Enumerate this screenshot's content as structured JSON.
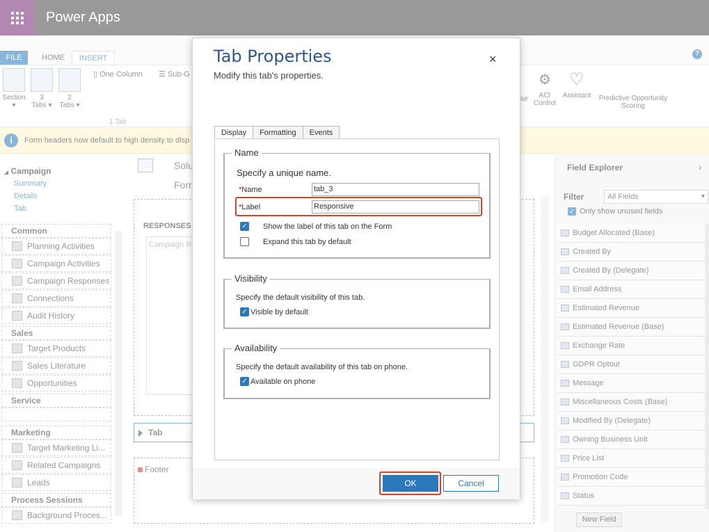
{
  "app": {
    "title": "Power Apps"
  },
  "ribbon": {
    "tabs": [
      "FILE",
      "HOME",
      "INSERT"
    ],
    "buttons": {
      "section": "Section",
      "three_tabs": [
        "3",
        "Tabs"
      ],
      "two_tabs": [
        "2",
        "Tabs"
      ],
      "one_column": "One Column",
      "sub_grid": "Sub-G",
      "ose": "se",
      "aci": [
        "ACI",
        "Control"
      ],
      "assistant": "Assistant",
      "predictive": [
        "Predictive Opportunity",
        "Scoring"
      ]
    },
    "group_label": "1 Tab"
  },
  "infobar": {
    "text": "Form headers now default to high density to disp"
  },
  "leftnav": {
    "campaign": "Campaign",
    "links": [
      "Summary",
      "Details",
      "Tab"
    ],
    "sections": {
      "common": "Common",
      "sales": "Sales",
      "service": "Service",
      "marketing": "Marketing",
      "process": "Process Sessions"
    },
    "common_items": [
      "Planning Activities",
      "Campaign Activities",
      "Campaign Responses",
      "Connections",
      "Audit History"
    ],
    "sales_items": [
      "Target Products",
      "Sales Literature",
      "Opportunities"
    ],
    "marketing_items": [
      "Target Marketing Li...",
      "Related Campaigns",
      "Leads"
    ],
    "process_items": [
      "Background Proces..."
    ]
  },
  "canvas": {
    "title1": "Solu",
    "title2": "Forr",
    "responses": "RESPONSES",
    "campaign_r": "Campaign Re",
    "tab": "Tab",
    "footer": "Footer"
  },
  "field_explorer": {
    "title": "Field Explorer",
    "filter_label": "Filter",
    "filter_value": "All Fields",
    "only_unused": "Only show unused fields",
    "fields": [
      "Budget Allocated (Base)",
      "Created By",
      "Created By (Delegate)",
      "Email Address",
      "Estimated Revenue",
      "Estimated Revenue (Base)",
      "Exchange Rate",
      "GDPR Optout",
      "Message",
      "Miscellaneous Costs (Base)",
      "Modified By (Delegate)",
      "Owning Business Unit",
      "Price List",
      "Promotion Code",
      "Status"
    ],
    "new_field": "New Field"
  },
  "dialog": {
    "title": "Tab Properties",
    "subtitle": "Modify this tab's properties.",
    "close": "×",
    "tabs": [
      "Display",
      "Formatting",
      "Events"
    ],
    "name_section": {
      "legend": "Name",
      "hint": "Specify a unique name.",
      "name_label": "Name",
      "name_value": "tab_3",
      "label_label": "Label",
      "label_value": "Responsive",
      "required_mark": "*",
      "show_label": "Show the label of this tab on the Form",
      "show_label_checked": true,
      "expand": "Expand this tab by default",
      "expand_checked": false
    },
    "visibility_section": {
      "legend": "Visibility",
      "hint": "Specify the default visibility of this tab.",
      "visible": "Visible by default",
      "visible_checked": true
    },
    "availability_section": {
      "legend": "Availability",
      "hint": "Specify the default availability of this tab on phone.",
      "available": "Available on phone",
      "available_checked": true
    },
    "ok": "OK",
    "cancel": "Cancel"
  }
}
